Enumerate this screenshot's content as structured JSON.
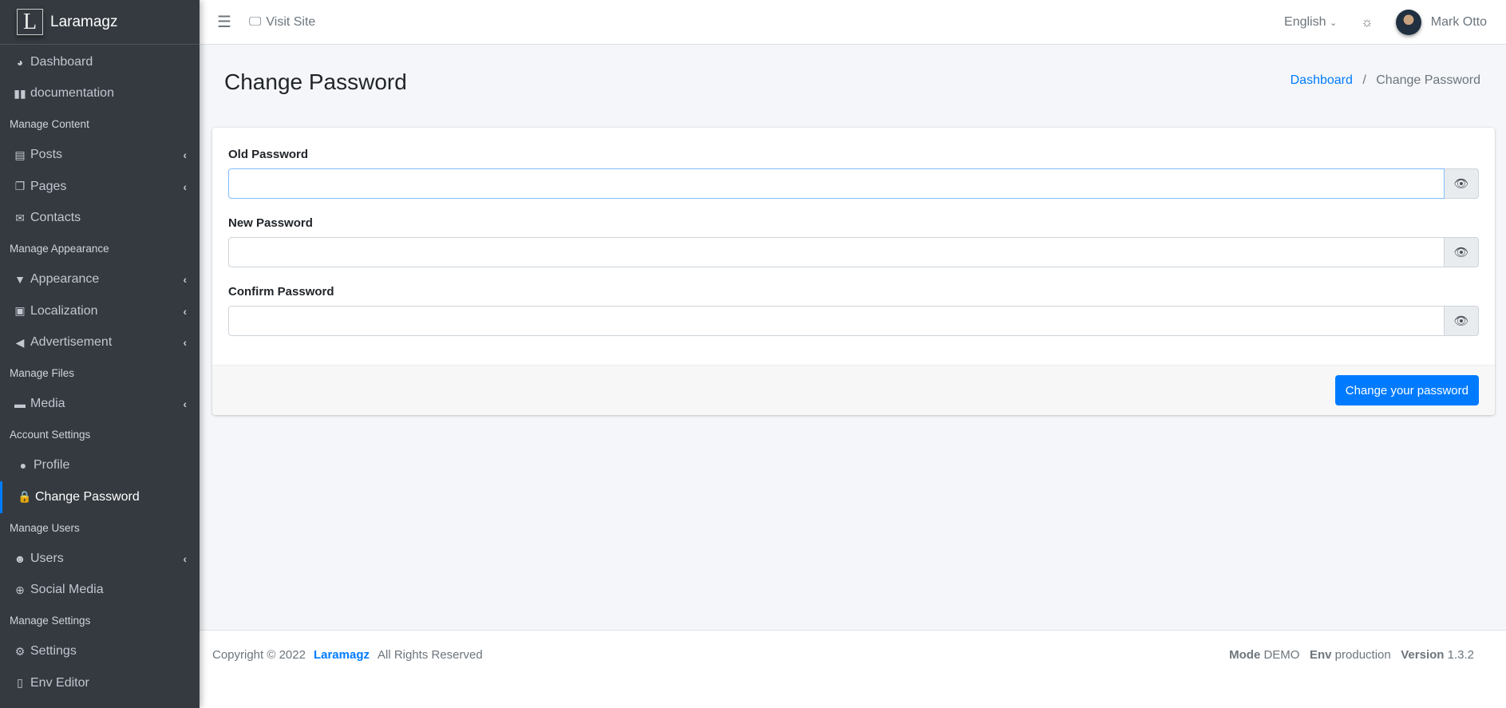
{
  "brand": {
    "logo_letter": "L",
    "name": "Laramagz"
  },
  "sidebar": [
    {
      "type": "item",
      "label": "Dashboard",
      "icon": "◕",
      "chev": false
    },
    {
      "type": "item",
      "label": "documentation",
      "icon": "▮▮",
      "chev": false
    },
    {
      "type": "head",
      "label": "Manage Content"
    },
    {
      "type": "item",
      "label": "Posts",
      "icon": "▤",
      "chev": true
    },
    {
      "type": "item",
      "label": "Pages",
      "icon": "❐",
      "chev": true
    },
    {
      "type": "item",
      "label": "Contacts",
      "icon": "✉",
      "chev": false
    },
    {
      "type": "head",
      "label": "Manage Appearance"
    },
    {
      "type": "item",
      "label": "Appearance",
      "icon": "▼",
      "chev": true
    },
    {
      "type": "item",
      "label": "Localization",
      "icon": "▣",
      "chev": true
    },
    {
      "type": "item",
      "label": "Advertisement",
      "icon": "◀",
      "chev": true
    },
    {
      "type": "head",
      "label": "Manage Files"
    },
    {
      "type": "item",
      "label": "Media",
      "icon": "▬",
      "chev": true
    },
    {
      "type": "head",
      "label": "Account Settings"
    },
    {
      "type": "sub",
      "label": "Profile",
      "icon": "●",
      "chev": false
    },
    {
      "type": "active",
      "label": "Change Password",
      "icon": "🔒",
      "chev": false
    },
    {
      "type": "head",
      "label": "Manage Users"
    },
    {
      "type": "item",
      "label": "Users",
      "icon": "☻",
      "chev": true
    },
    {
      "type": "item",
      "label": "Social Media",
      "icon": "⊕",
      "chev": false
    },
    {
      "type": "head",
      "label": "Manage Settings"
    },
    {
      "type": "item",
      "label": "Settings",
      "icon": "⚙",
      "chev": false
    },
    {
      "type": "item",
      "label": "Env Editor",
      "icon": "▯",
      "chev": false
    }
  ],
  "header": {
    "visit_site": "Visit Site",
    "language": "English",
    "user": "Mark Otto"
  },
  "page": {
    "title": "Change Password",
    "breadcrumb": {
      "home": "Dashboard",
      "current": "Change Password"
    }
  },
  "form": {
    "old_label": "Old Password",
    "new_label": "New Password",
    "confirm_label": "Confirm Password",
    "submit": "Change your password"
  },
  "footer": {
    "copyright": "Copyright © 2022",
    "brand": "Laramagz",
    "rights": "All Rights Reserved",
    "mode_label": "Mode",
    "mode": "DEMO",
    "env_label": "Env",
    "env": "production",
    "version_label": "Version",
    "version": "1.3.2"
  }
}
